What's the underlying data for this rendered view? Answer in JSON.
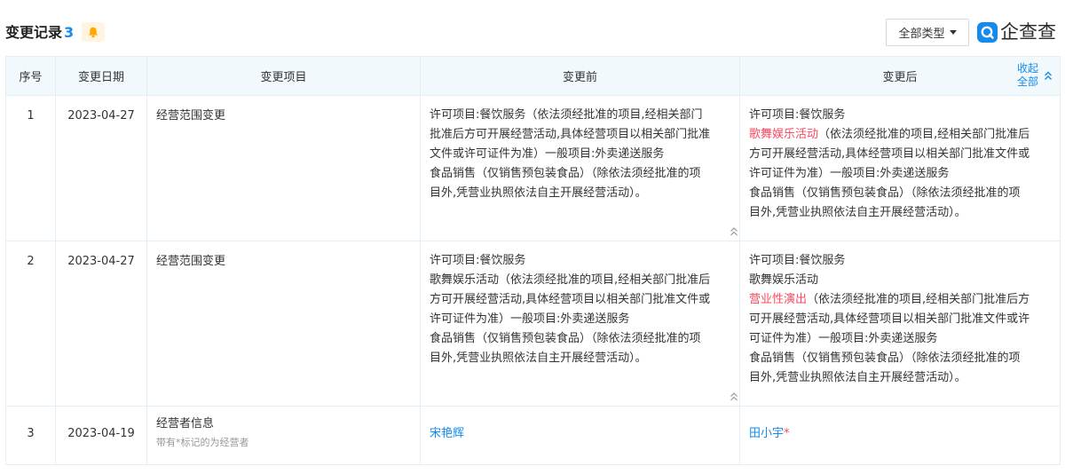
{
  "header": {
    "title": "变更记录",
    "count": "3",
    "type_filter": "全部类型",
    "logo_text": "企查查"
  },
  "table": {
    "columns": [
      "序号",
      "变更日期",
      "变更项目",
      "变更前",
      "变更后"
    ],
    "collapse_all_label": "收起全部",
    "rows": [
      {
        "index": "1",
        "date": "2023-04-27",
        "item": "经营范围变更",
        "before": {
          "lines": [
            "许可项目:餐饮服务（依法须经批准的项目,经相关部门",
            "批准后方可开展经营活动,具体经营项目以相关部门批准",
            "文件或许可证件为准）一般项目:外卖递送服务",
            "食品销售（仅销售预包装食品）（除依法须经批准的项",
            "目外,凭营业执照依法自主开展经营活动）。"
          ]
        },
        "after": {
          "line1": "许可项目:餐饮服务",
          "highlight": "歌舞娱乐活动",
          "line2_rest": "（依法须经批准的项目,经相关部门批准后",
          "lines_rest": [
            "方可开展经营活动,具体经营项目以相关部门批准文件或",
            "许可证件为准）一般项目:外卖递送服务",
            "食品销售（仅销售预包装食品）（除依法须经批准的项",
            "目外,凭营业执照依法自主开展经营活动）。"
          ]
        }
      },
      {
        "index": "2",
        "date": "2023-04-27",
        "item": "经营范围变更",
        "before": {
          "lines": [
            "许可项目:餐饮服务",
            "歌舞娱乐活动（依法须经批准的项目,经相关部门批准后",
            "方可开展经营活动,具体经营项目以相关部门批准文件或",
            "许可证件为准）一般项目:外卖递送服务",
            "食品销售（仅销售预包装食品）（除依法须经批准的项",
            "目外,凭营业执照依法自主开展经营活动）。"
          ]
        },
        "after": {
          "line1": "许可项目:餐饮服务",
          "line2": "歌舞娱乐活动",
          "highlight": "营业性演出",
          "line3_rest": "（依法须经批准的项目,经相关部门批准后方",
          "lines_rest": [
            "可开展经营活动,具体经营项目以相关部门批准文件或许",
            "可证件为准）一般项目:外卖递送服务",
            "食品销售（仅销售预包装食品）（除依法须经批准的项",
            "目外,凭营业执照依法自主开展经营活动）。"
          ]
        }
      },
      {
        "index": "3",
        "date": "2023-04-19",
        "item": "经营者信息",
        "item_hint": "带有*标记的为经营者",
        "before_link": "宋艳辉",
        "after_link": "田小宇",
        "after_mark": "*"
      }
    ]
  },
  "colors": {
    "accent": "#128bed",
    "highlight_red": "#fd485e",
    "header_bg": "#f2f9fc",
    "border": "#e4eef6",
    "bell_bg": "#fff4e0",
    "bell": "#ffaa00"
  },
  "icons": [
    "bell-icon",
    "caret-down-icon",
    "qcc-logo-icon",
    "double-chevron-up-icon"
  ]
}
